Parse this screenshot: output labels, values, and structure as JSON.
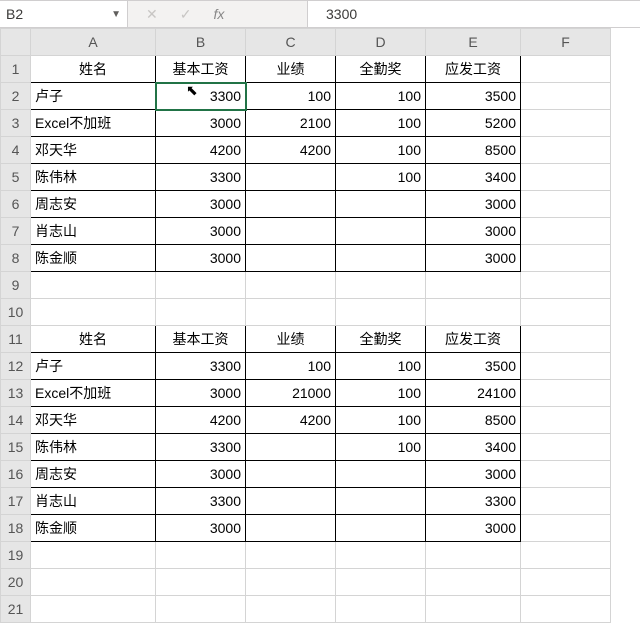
{
  "formula_bar": {
    "name_box": "B2",
    "cancel_icon": "✕",
    "enter_icon": "✓",
    "fx_label": "fx",
    "value": "3300"
  },
  "columns": [
    "A",
    "B",
    "C",
    "D",
    "E",
    "F"
  ],
  "row_headers": [
    "1",
    "2",
    "3",
    "4",
    "5",
    "6",
    "7",
    "8",
    "9",
    "10",
    "11",
    "12",
    "13",
    "14",
    "15",
    "16",
    "17",
    "18",
    "19",
    "20",
    "21"
  ],
  "header_row": {
    "c1": "姓名",
    "c2": "基本工资",
    "c3": "业绩",
    "c4": "全勤奖",
    "c5": "应发工资"
  },
  "table1": [
    {
      "c1": "卢子",
      "c2": "3300",
      "c3": "100",
      "c4": "100",
      "c5": "3500"
    },
    {
      "c1": "Excel不加班",
      "c2": "3000",
      "c3": "2100",
      "c4": "100",
      "c5": "5200"
    },
    {
      "c1": "邓天华",
      "c2": "4200",
      "c3": "4200",
      "c4": "100",
      "c5": "8500"
    },
    {
      "c1": "陈伟林",
      "c2": "3300",
      "c3": "",
      "c4": "100",
      "c5": "3400"
    },
    {
      "c1": "周志安",
      "c2": "3000",
      "c3": "",
      "c4": "",
      "c5": "3000"
    },
    {
      "c1": "肖志山",
      "c2": "3000",
      "c3": "",
      "c4": "",
      "c5": "3000"
    },
    {
      "c1": "陈金顺",
      "c2": "3000",
      "c3": "",
      "c4": "",
      "c5": "3000"
    }
  ],
  "table2": [
    {
      "c1": "卢子",
      "c2": "3300",
      "c3": "100",
      "c4": "100",
      "c5": "3500"
    },
    {
      "c1": "Excel不加班",
      "c2": "3000",
      "c3": "21000",
      "c4": "100",
      "c5": "24100"
    },
    {
      "c1": "邓天华",
      "c2": "4200",
      "c3": "4200",
      "c4": "100",
      "c5": "8500"
    },
    {
      "c1": "陈伟林",
      "c2": "3300",
      "c3": "",
      "c4": "100",
      "c5": "3400"
    },
    {
      "c1": "周志安",
      "c2": "3000",
      "c3": "",
      "c4": "",
      "c5": "3000"
    },
    {
      "c1": "肖志山",
      "c2": "3300",
      "c3": "",
      "c4": "",
      "c5": "3300"
    },
    {
      "c1": "陈金顺",
      "c2": "3000",
      "c3": "",
      "c4": "",
      "c5": "3000"
    }
  ],
  "cursor_glyph": "↖",
  "chart_data": {
    "type": "table",
    "tables": [
      {
        "columns": [
          "姓名",
          "基本工资",
          "业绩",
          "全勤奖",
          "应发工资"
        ],
        "rows": [
          [
            "卢子",
            3300,
            100,
            100,
            3500
          ],
          [
            "Excel不加班",
            3000,
            2100,
            100,
            5200
          ],
          [
            "邓天华",
            4200,
            4200,
            100,
            8500
          ],
          [
            "陈伟林",
            3300,
            null,
            100,
            3400
          ],
          [
            "周志安",
            3000,
            null,
            null,
            3000
          ],
          [
            "肖志山",
            3000,
            null,
            null,
            3000
          ],
          [
            "陈金顺",
            3000,
            null,
            null,
            3000
          ]
        ]
      },
      {
        "columns": [
          "姓名",
          "基本工资",
          "业绩",
          "全勤奖",
          "应发工资"
        ],
        "rows": [
          [
            "卢子",
            3300,
            100,
            100,
            3500
          ],
          [
            "Excel不加班",
            3000,
            21000,
            100,
            24100
          ],
          [
            "邓天华",
            4200,
            4200,
            100,
            8500
          ],
          [
            "陈伟林",
            3300,
            null,
            100,
            3400
          ],
          [
            "周志安",
            3000,
            null,
            null,
            3000
          ],
          [
            "肖志山",
            3300,
            null,
            null,
            3300
          ],
          [
            "陈金顺",
            3000,
            null,
            null,
            3000
          ]
        ]
      }
    ]
  }
}
